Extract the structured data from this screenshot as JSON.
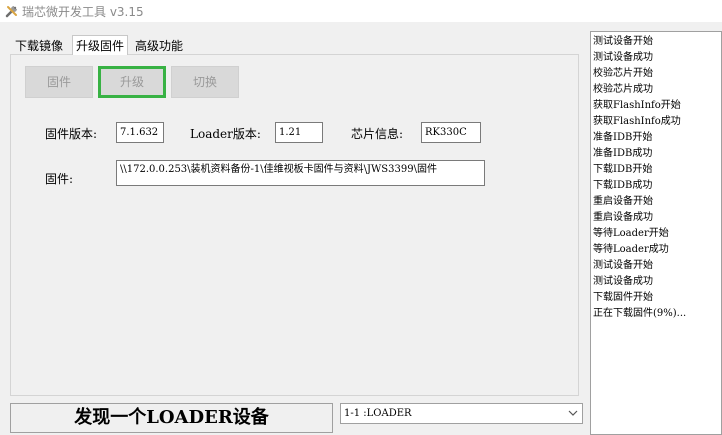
{
  "window": {
    "title": "瑞芯微开发工具 v3.15"
  },
  "tabs": [
    "下载镜像",
    "升级固件",
    "高级功能"
  ],
  "buttons": {
    "firmware": "固件",
    "upgrade": "升级",
    "switch": "切换"
  },
  "info": {
    "fw_version_label": "固件版本:",
    "fw_version": "7.1.632",
    "loader_version_label": "Loader版本:",
    "loader_version": "1.21",
    "chip_info_label": "芯片信息:",
    "chip_info": "RK330C",
    "firmware_label": "固件:",
    "firmware_path": "\\\\172.0.0.253\\装机资料备份-1\\佳维视板卡固件与资料\\JWS3399\\固件"
  },
  "status": {
    "message": "发现一个LOADER设备"
  },
  "device_select": {
    "value": "1-1 :LOADER"
  },
  "log": [
    "测试设备开始",
    "测试设备成功",
    "校验芯片开始",
    "校验芯片成功",
    "获取FlashInfo开始",
    "获取FlashInfo成功",
    "准备IDB开始",
    "准备IDB成功",
    "下载IDB开始",
    "下载IDB成功",
    "重启设备开始",
    "重启设备成功",
    "等待Loader开始",
    "等待Loader成功",
    "测试设备开始",
    "测试设备成功",
    "下载固件开始",
    "正在下载固件(9%)..."
  ]
}
